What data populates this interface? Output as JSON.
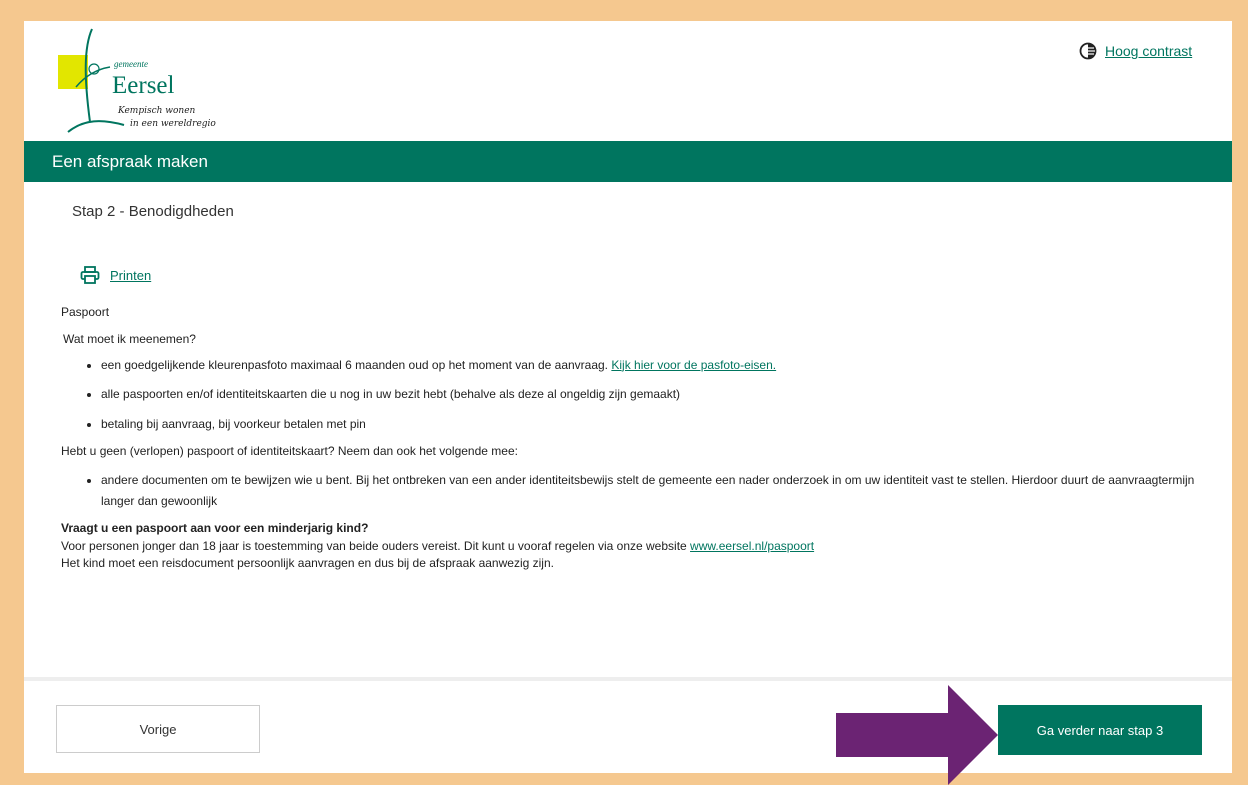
{
  "logo": {
    "prefix": "gemeente",
    "name": "Eersel",
    "tagline_line1": "Kempisch wonen",
    "tagline_line2": "in een wereldregio",
    "colors": {
      "leaf": "#e2e600",
      "stem": "#00755f"
    }
  },
  "header": {
    "contrast_icon": "contrast-icon",
    "contrast_label": "Hoog contrast"
  },
  "titlebar": {
    "title": "Een afspraak maken",
    "color": "#00755f"
  },
  "step": {
    "label": "Stap 2 - Benodigdheden"
  },
  "print": {
    "icon": "printer-icon",
    "label": "Printen"
  },
  "content": {
    "heading": "Paspoort",
    "question": "Wat moet ik meenemen?",
    "items": [
      {
        "text": "een goedgelijkende kleurenpasfoto maximaal 6 maanden oud op het moment van de aanvraag. ",
        "link": "Kijk hier voor de pasfoto-eisen."
      },
      {
        "text": "alle paspoorten en/of identiteitskaarten die u nog in uw bezit hebt (behalve als deze al ongeldig zijn gemaakt)"
      },
      {
        "text": "betaling bij aanvraag, bij voorkeur betalen met pin"
      }
    ],
    "no_passport_text": "Hebt u geen (verlopen) paspoort of identiteitskaart? Neem dan ook het volgende mee:",
    "extra_items": [
      {
        "text": "andere documenten om te bewijzen wie u bent. Bij het ontbreken van een ander identiteitsbewijs stelt de gemeente een nader onderzoek in om uw identiteit vast te stellen. Hierdoor duurt de aanvraagtermijn langer dan gewoonlijk"
      }
    ],
    "minor_heading": "Vraagt u een paspoort aan voor een minderjarig kind?",
    "minor_text": "Voor personen jonger dan 18 jaar is toestemming van beide ouders vereist. Dit kunt u vooraf regelen via onze website ",
    "minor_link": "www.eersel.nl/paspoort",
    "child_text": "Het kind moet een reisdocument persoonlijk aanvragen en dus bij de afspraak aanwezig zijn."
  },
  "footer": {
    "prev_label": "Vorige",
    "next_label": "Ga verder naar stap 3",
    "arrow_color": "#6b2373",
    "arrow_icon": "arrow-right-icon"
  }
}
